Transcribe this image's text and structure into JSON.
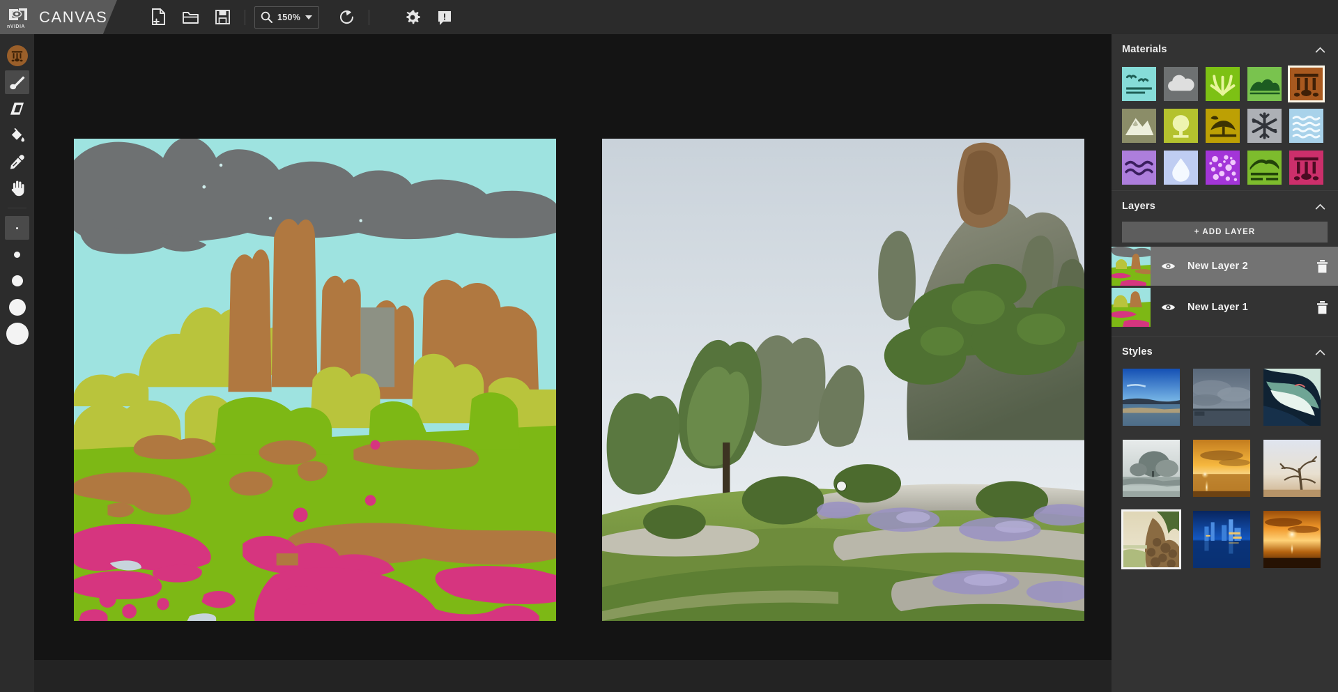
{
  "app": {
    "brand_logo": "nvidia-logo",
    "brand_logo_word": "nVIDIA",
    "brand_name": "CANVAS"
  },
  "toolbar": {
    "items": [
      {
        "id": "new-document",
        "icon": "new-file-icon",
        "label": "New"
      },
      {
        "id": "open-document",
        "icon": "open-folder-icon",
        "label": "Open"
      },
      {
        "id": "save-document",
        "icon": "save-disk-icon",
        "label": "Save"
      }
    ],
    "zoom": {
      "icon": "magnifier-icon",
      "value": "150%"
    },
    "reset": {
      "icon": "reset-rotate-icon",
      "label": "Reset"
    },
    "settings": {
      "icon": "gear-icon",
      "label": "Settings"
    },
    "help": {
      "icon": "info-bubble-icon",
      "label": "Help"
    }
  },
  "left_tools": {
    "material_swatch": {
      "icon": "ruins-material-icon",
      "color": "#9a5f2a",
      "selected": false
    },
    "tools": [
      {
        "id": "paintbrush",
        "icon": "paintbrush-icon",
        "label": "Paint Brush",
        "selected": true
      },
      {
        "id": "eraser",
        "icon": "eraser-icon",
        "label": "Eraser",
        "selected": false
      },
      {
        "id": "fill",
        "icon": "paint-bucket-icon",
        "label": "Fill",
        "selected": false
      },
      {
        "id": "eyedropper",
        "icon": "eyedropper-icon",
        "label": "Eyedropper",
        "selected": false
      },
      {
        "id": "pan",
        "icon": "hand-pan-icon",
        "label": "Pan",
        "selected": false
      }
    ],
    "brush_sizes": [
      {
        "id": "size-1",
        "diameter": 3,
        "selected": true
      },
      {
        "id": "size-2",
        "diameter": 9,
        "selected": false
      },
      {
        "id": "size-3",
        "diameter": 16,
        "selected": false
      },
      {
        "id": "size-4",
        "diameter": 24,
        "selected": false
      },
      {
        "id": "size-5",
        "diameter": 32,
        "selected": false
      }
    ]
  },
  "canvas": {
    "segmentation_label": "segmentation-canvas",
    "output_label": "rendered-output-canvas",
    "palette": {
      "sky": "#9EE3E0",
      "cloud": "#6E7172",
      "grass": "#7DB815",
      "bush": "#B9C43C",
      "ruins": "#B07840",
      "rock": "#D6357F",
      "stone_gray": "#8D9184"
    }
  },
  "materials": {
    "title": "Materials",
    "collapse_icon": "chevron-up-icon",
    "items": [
      {
        "id": "sea",
        "icon": "sea-birds-icon",
        "bg": "#86DCD8",
        "fg": "#1E5E55",
        "selected": false
      },
      {
        "id": "cloud",
        "icon": "cloud-icon",
        "bg": "#6E7172",
        "fg": "#DEDEDE",
        "selected": false
      },
      {
        "id": "grass",
        "icon": "grass-icon",
        "bg": "#7DC114",
        "fg": "#E7F59B",
        "selected": false
      },
      {
        "id": "bush",
        "icon": "bush-hills-icon",
        "bg": "#79C34E",
        "fg": "#1C5B21",
        "selected": false
      },
      {
        "id": "ruins",
        "icon": "ruins-icon",
        "bg": "#A8591F",
        "fg": "#3E2007",
        "selected": true
      },
      {
        "id": "mountain",
        "icon": "mountain-icon",
        "bg": "#8B8D68",
        "fg": "#EDEFDC",
        "selected": false
      },
      {
        "id": "tree",
        "icon": "tree-icon",
        "bg": "#B4C22E",
        "fg": "#EEF4B0",
        "selected": false
      },
      {
        "id": "jungle",
        "icon": "palm-tree-icon",
        "bg": "#BDA004",
        "fg": "#3C3203",
        "selected": false
      },
      {
        "id": "snow",
        "icon": "snowflake-icon",
        "bg": "#ADB0B5",
        "fg": "#31343A",
        "selected": false
      },
      {
        "id": "water",
        "icon": "water-waves-icon",
        "bg": "#A8D2EA",
        "fg": "#F2FAFE",
        "selected": false
      },
      {
        "id": "river",
        "icon": "river-icon",
        "bg": "#AD7EDC",
        "fg": "#3A1E5E",
        "selected": false
      },
      {
        "id": "fog",
        "icon": "water-drop-icon",
        "bg": "#BFCDF2",
        "fg": "#F4F9FF",
        "selected": false
      },
      {
        "id": "flowers",
        "icon": "flowers-icon",
        "bg": "#A335D8",
        "fg": "#F0C9FC",
        "selected": false
      },
      {
        "id": "hill",
        "icon": "hill-icon",
        "bg": "#7DBC2D",
        "fg": "#22430A",
        "selected": false
      },
      {
        "id": "ruins2",
        "icon": "ruins-pink-icon",
        "bg": "#CC2F6B",
        "fg": "#4B0B22",
        "selected": false
      }
    ]
  },
  "layers": {
    "title": "Layers",
    "collapse_icon": "chevron-up-icon",
    "add_layer_label": "+ ADD LAYER",
    "items": [
      {
        "name": "New Layer 2",
        "visible": true,
        "selected": true,
        "eye_icon": "eye-icon",
        "delete_icon": "trash-icon"
      },
      {
        "name": "New Layer 1",
        "visible": true,
        "selected": false,
        "eye_icon": "eye-icon",
        "delete_icon": "trash-icon"
      }
    ]
  },
  "styles": {
    "title": "Styles",
    "collapse_icon": "chevron-up-icon",
    "items": [
      {
        "id": "style-1",
        "name": "blue-sunset-shore",
        "selected": false,
        "c1": "#1c5fbe",
        "c2": "#7fb6e8",
        "c3": "#f0a44a",
        "c4": "#2a3a4a"
      },
      {
        "id": "style-2",
        "name": "overcast-sea",
        "selected": false,
        "c1": "#5b6878",
        "c2": "#8d99a6",
        "c3": "#3f4a57",
        "c4": "#2f3740"
      },
      {
        "id": "style-3",
        "name": "abstract-wave",
        "selected": false,
        "c1": "#0e2033",
        "c2": "#bfe0d4",
        "c3": "#4e8f7f",
        "c4": "#e6f2ec"
      },
      {
        "id": "style-4",
        "name": "monochrome-lake",
        "selected": false,
        "c1": "#dfe4e4",
        "c2": "#8c9a96",
        "c3": "#4e5a58",
        "c4": "#b8c2c0"
      },
      {
        "id": "style-5",
        "name": "golden-sunset",
        "selected": false,
        "c1": "#f7b23c",
        "c2": "#c6721c",
        "c3": "#6b3a12",
        "c4": "#ffe9a8"
      },
      {
        "id": "style-6",
        "name": "bare-tree-dusk",
        "selected": false,
        "c1": "#d9dde8",
        "c2": "#c8a97f",
        "c3": "#5b4a33",
        "c4": "#efeae0"
      },
      {
        "id": "style-7",
        "name": "rocky-coast",
        "selected": true,
        "c1": "#e6dcbf",
        "c2": "#8a6b42",
        "c3": "#4e6b33",
        "c4": "#c9b58c"
      },
      {
        "id": "style-8",
        "name": "blue-city-night",
        "selected": false,
        "c1": "#0d3b8c",
        "c2": "#1456c4",
        "c3": "#f0c66a",
        "c4": "#061f4d"
      },
      {
        "id": "style-9",
        "name": "orange-sun-sea",
        "selected": false,
        "c1": "#f59a1e",
        "c2": "#b4560c",
        "c3": "#2b1504",
        "c4": "#ffe2a0"
      }
    ]
  }
}
